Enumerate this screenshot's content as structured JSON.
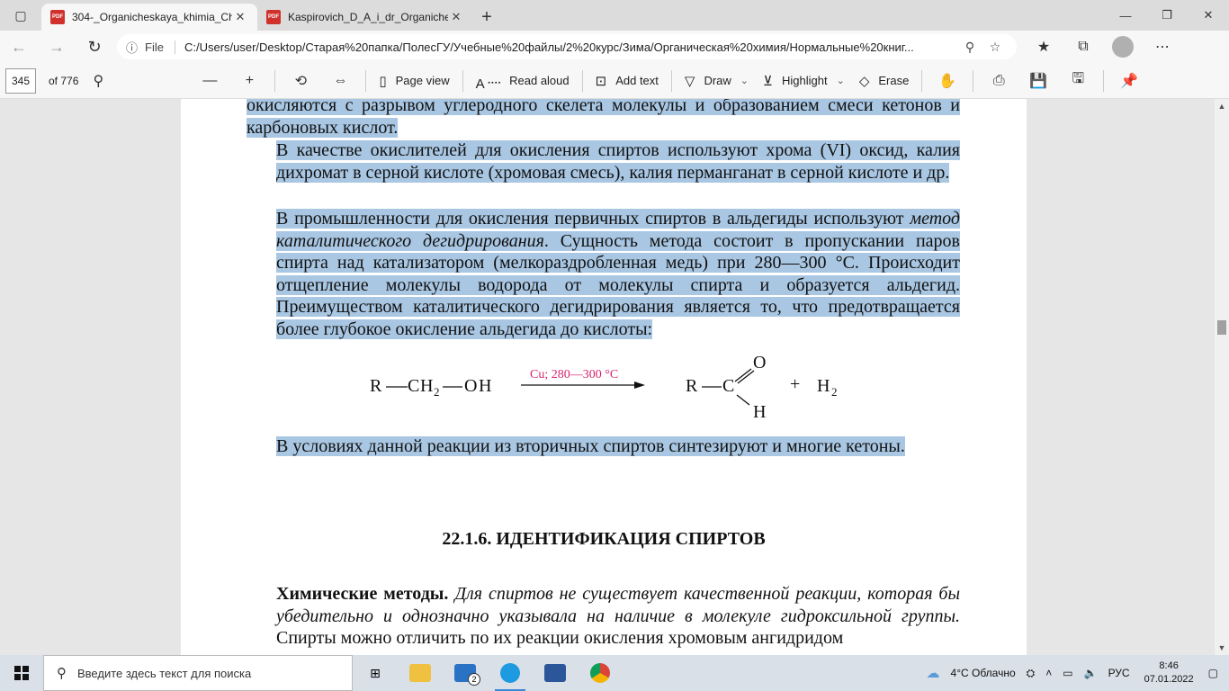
{
  "browser": {
    "tabs": [
      {
        "title": "304-_Organicheskaya_khimia_Ch",
        "active": true,
        "badge": "PDF"
      },
      {
        "title": "Kaspirovich_D_A_i_dr_Organiche",
        "active": false,
        "badge": "PDF"
      }
    ],
    "address": {
      "file_label": "File",
      "url": "C:/Users/user/Desktop/Старая%20папка/ПолесГУ/Учебные%20файлы/2%20курс/Зима/Органическая%20химия/Нормальные%20книг..."
    }
  },
  "pdf_toolbar": {
    "page": "345",
    "total": "of 776",
    "page_view": "Page view",
    "read_aloud": "Read aloud",
    "add_text": "Add text",
    "draw": "Draw",
    "highlight": "Highlight",
    "erase": "Erase"
  },
  "document": {
    "para1": "окисляются с разрывом углеродного скелета молекулы и образованием смеси кетонов и карбоновых кислот.",
    "para2": "В качестве окислителей для окисления спиртов используют хрома (VI) оксид, калия дихромат в серной кислоте (хромовая смесь), калия перманганат в серной кислоте и др.",
    "para3_a": "В промышленности для окисления первичных спиртов в альдегиды используют ",
    "para3_it": "метод каталитического дегидрирования",
    "para3_b": ". Сущность метода состоит в пропускании паров спирта над катализатором (мелкораздробленная медь) при 280—300 °С. Происходит отщепление молекулы водорода от молекулы спирта и образуется альдегид. Преимуществом каталитического дегидрирования является то, что предотвращается более глубокое окисление альдегида до кислоты:",
    "reaction": {
      "r1": "R",
      "c1": "C",
      "h2": "H",
      "sub2": "2",
      "o1": "O",
      "h1": "H",
      "condition": "Cu; 280—300 °C",
      "r2": "R",
      "c2": "C",
      "o2": "O",
      "h_ald": "H",
      "plus": "+",
      "h2_prod": "H",
      "sub2_prod": "2"
    },
    "para4": "В условиях данной реакции из вторичных спиртов синтезируют и многие кетоны.",
    "heading": "22.1.6. ИДЕНТИФИКАЦИЯ СПИРТОВ",
    "para5_bold": "Химические методы.",
    "para5_it": " Для спиртов не существует качественной реакции, которая бы убедительно и однозначно указывала на наличие в молекуле гидроксильной группы.",
    "para5_rest": " Спирты можно отличить по их реакции окисления хромовым ангидридом"
  },
  "taskbar": {
    "search_placeholder": "Введите здесь текст для поиска",
    "mail_badge": "2",
    "weather": "4°C  Облачно",
    "lang": "РУС",
    "time": "8:46",
    "date": "07.01.2022"
  },
  "colors": {
    "highlight": "#a9c7e3",
    "carbon": "#1aa5dc",
    "condition": "#d6246e"
  }
}
